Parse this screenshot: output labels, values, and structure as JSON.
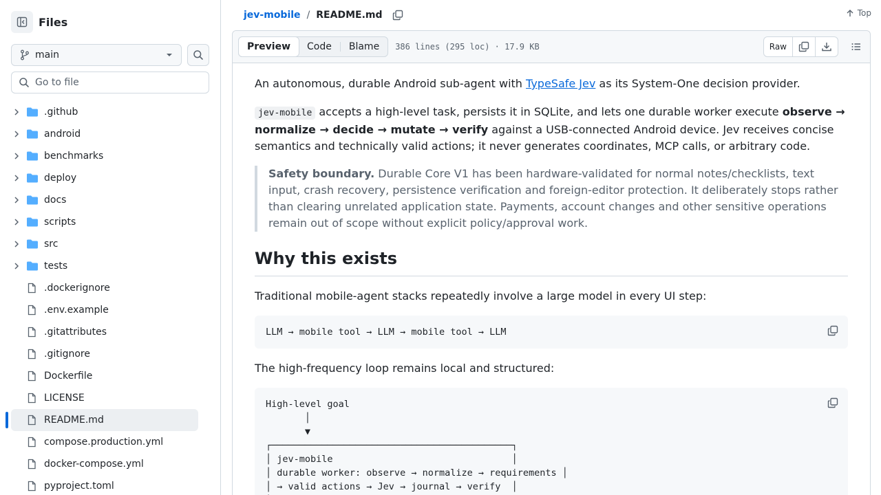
{
  "sidebar": {
    "title": "Files",
    "branch": "main",
    "go_to_file_placeholder": "Go to file",
    "tree": [
      {
        "name": ".github",
        "type": "folder"
      },
      {
        "name": "android",
        "type": "folder"
      },
      {
        "name": "benchmarks",
        "type": "folder"
      },
      {
        "name": "deploy",
        "type": "folder"
      },
      {
        "name": "docs",
        "type": "folder"
      },
      {
        "name": "scripts",
        "type": "folder"
      },
      {
        "name": "src",
        "type": "folder"
      },
      {
        "name": "tests",
        "type": "folder"
      },
      {
        "name": ".dockerignore",
        "type": "file"
      },
      {
        "name": ".env.example",
        "type": "file"
      },
      {
        "name": ".gitattributes",
        "type": "file"
      },
      {
        "name": ".gitignore",
        "type": "file"
      },
      {
        "name": "Dockerfile",
        "type": "file"
      },
      {
        "name": "LICENSE",
        "type": "file"
      },
      {
        "name": "README.md",
        "type": "file",
        "active": true
      },
      {
        "name": "compose.production.yml",
        "type": "file"
      },
      {
        "name": "docker-compose.yml",
        "type": "file"
      },
      {
        "name": "pyproject.toml",
        "type": "file"
      }
    ]
  },
  "breadcrumb": {
    "repo": "jev-mobile",
    "separator": "/",
    "file": "README.md"
  },
  "top_link": "Top",
  "file_header": {
    "tabs": [
      "Preview",
      "Code",
      "Blame"
    ],
    "active_tab": "Preview",
    "info": "386 lines (295 loc) · 17.9 KB",
    "raw_label": "Raw"
  },
  "readme": {
    "p1_before": "An autonomous, durable Android sub-agent with ",
    "p1_link": "TypeSafe Jev",
    "p1_after": " as its System-One decision provider.",
    "p2_code": "jev-mobile",
    "p2_text1": " accepts a high-level task, persists it in SQLite, and lets one durable worker execute ",
    "p2_bold": "observe → normalize → decide → mutate → verify",
    "p2_text2": " against a USB-connected Android device. Jev receives concise semantics and technically valid actions; it never generates coordinates, MCP calls, or arbitrary code.",
    "quote_bold": "Safety boundary.",
    "quote_text": " Durable Core V1 has been hardware-validated for normal notes/checklists, text input, crash recovery, persistence verification and foreign-editor protection. It deliberately stops rather than clearing unrelated application state. Payments, account changes and other sensitive operations remain out of scope without explicit policy/approval work.",
    "h2": "Why this exists",
    "p3": "Traditional mobile-agent stacks repeatedly involve a large model in every UI step:",
    "code1": "LLM → mobile tool → LLM → mobile tool → LLM",
    "p4": "The high-frequency loop remains local and structured:",
    "code2": "High-level goal\n       │\n       ▼\n┌───────────────────────────────────────────┐\n│ jev-mobile                                │\n│ durable worker: observe → normalize → requirements │\n│ → valid actions → Jev → journal → verify  │\n│"
  }
}
